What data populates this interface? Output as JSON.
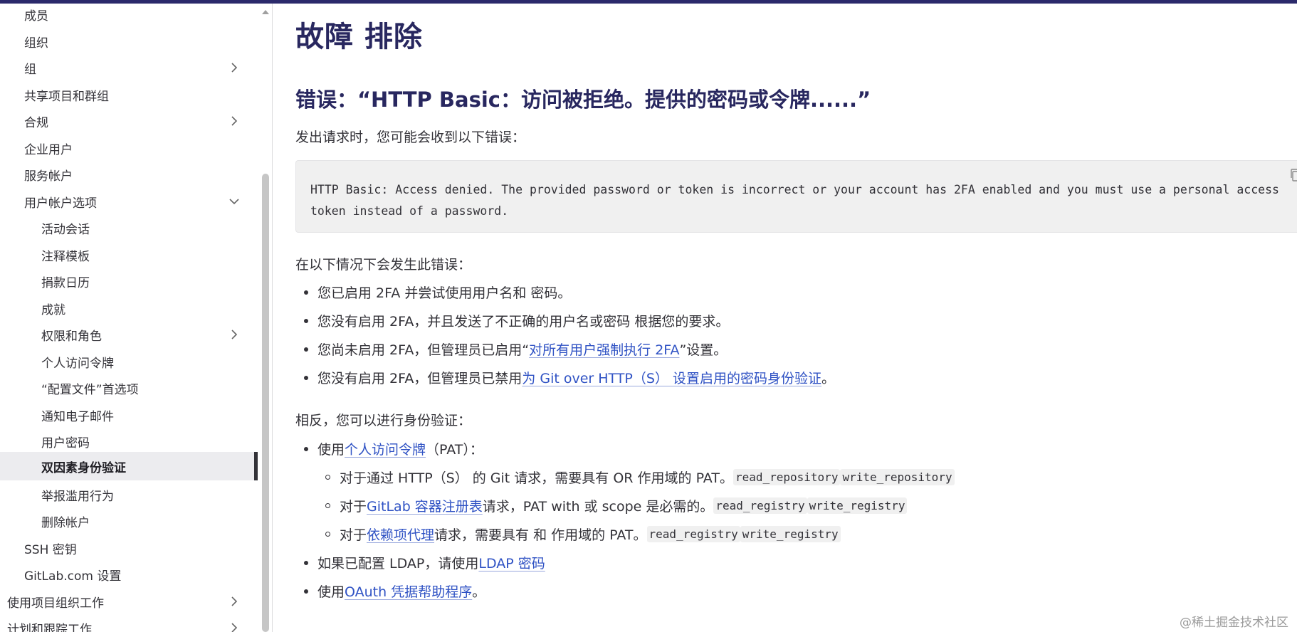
{
  "sidebar": {
    "items": [
      {
        "label": "成员"
      },
      {
        "label": "组织"
      },
      {
        "label": "组"
      },
      {
        "label": "共享项目和群组"
      },
      {
        "label": "合规"
      },
      {
        "label": "企业用户"
      },
      {
        "label": "服务帐户"
      },
      {
        "label": "用户帐户选项"
      },
      {
        "label": "活动会话"
      },
      {
        "label": "注释模板"
      },
      {
        "label": "捐款日历"
      },
      {
        "label": "成就"
      },
      {
        "label": "权限和角色"
      },
      {
        "label": "个人访问令牌"
      },
      {
        "label": "“配置文件”首选项"
      },
      {
        "label": "通知电子邮件"
      },
      {
        "label": "用户密码"
      },
      {
        "label": "双因素身份验证"
      },
      {
        "label": "举报滥用行为"
      },
      {
        "label": "删除帐户"
      },
      {
        "label": "SSH 密钥"
      },
      {
        "label": "GitLab.com 设置"
      },
      {
        "label": "使用项目组织工作"
      },
      {
        "label": "计划和跟踪工作"
      }
    ]
  },
  "main": {
    "title": "故障 排除",
    "error_heading": "错误：“HTTP Basic：访问被拒绝。提供的密码或令牌......”",
    "intro": "发出请求时，您可能会收到以下错误：",
    "code": "HTTP Basic: Access denied. The provided password or token is incorrect or your account has 2FA enabled and you must use a personal access token instead of a password.",
    "cases_intro": "在以下情况下会发生此错误：",
    "cases": [
      {
        "text": "您已启用 2FA 并尝试使用用户名和 密码。"
      },
      {
        "text": "您没有启用 2FA，并且发送了不正确的用户名或密码 根据您的要求。"
      },
      {
        "pre": "您尚未启用 2FA，但管理员已启用“",
        "link": "对所有用户强制执行 2FA",
        "post": "”设置。"
      },
      {
        "pre": "您没有启用 2FA，但管理员已禁用",
        "link": "为 Git over HTTP（S） 设置启用的密码身份验证",
        "post": "。"
      }
    ],
    "auth_intro": "相反，您可以进行身份验证：",
    "auth": {
      "pat": {
        "pre": "使用",
        "link": "个人访问令牌",
        "post": "（PAT）："
      },
      "sub": [
        {
          "pre": "对于通过 HTTP（S） 的 Git 请求，需要具有 OR 作用域的 PAT。",
          "code1": "read_repository",
          "code2": "write_repository"
        },
        {
          "pre": "对于 ",
          "link": "GitLab 容器注册表",
          "mid": "请求，PAT with 或 scope 是必需的。",
          "code1": "read_registry",
          "code2": "write_registry"
        },
        {
          "pre": "对于",
          "link": "依赖项代理",
          "mid": "请求，需要具有 和 作用域的 PAT。",
          "code1": "read_registry",
          "code2": "write_registry"
        }
      ],
      "ldap": {
        "pre": "如果已配置 LDAP，请使用 ",
        "link": "LDAP 密码"
      },
      "oauth": {
        "pre": "使用 ",
        "link": "OAuth 凭据帮助程序",
        "post": "。"
      }
    }
  },
  "watermark": "@稀土掘金技术社区",
  "colors": {
    "heading": "#28275f",
    "link": "#2f52c4",
    "topbar": "#2b2a6b",
    "active_bg": "#ececef"
  }
}
